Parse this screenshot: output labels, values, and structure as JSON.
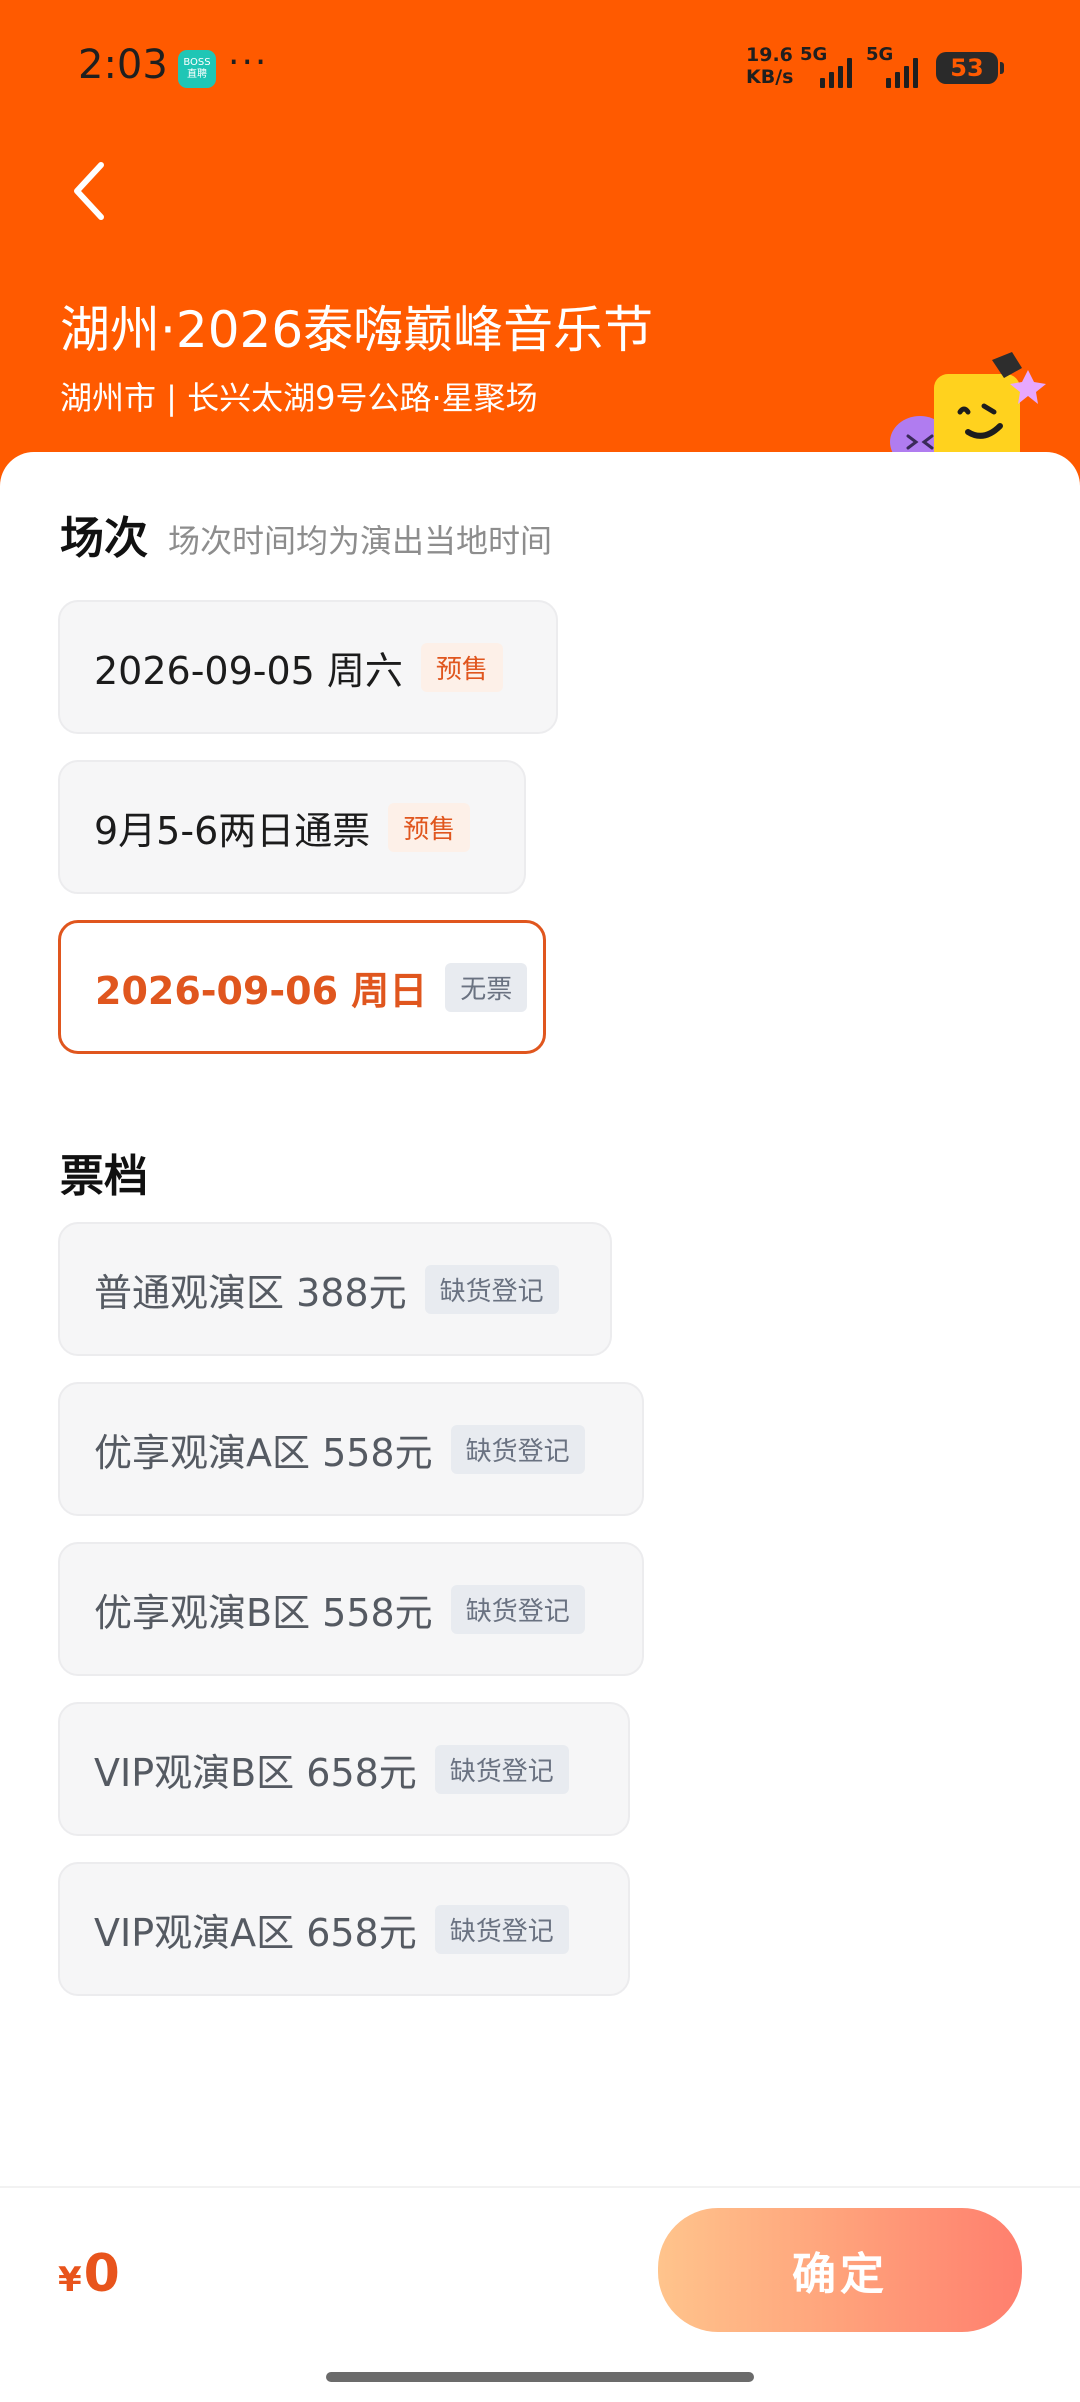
{
  "status_bar": {
    "time": "2:03",
    "app_badge_line1": "BOSS",
    "app_badge_line2": "直聘",
    "more": "···",
    "net_speed_value": "19.6",
    "net_speed_unit": "KB/s",
    "signal1_label": "5G",
    "signal2_label": "5G",
    "battery": "53"
  },
  "header": {
    "title": "湖州·2026泰嗨巅峰音乐节",
    "venue": "湖州市 | 长兴太湖9号公路·星聚场"
  },
  "sessions": {
    "title": "场次",
    "note": "场次时间均为演出当地时间",
    "items": [
      {
        "label": "2026-09-05  周六",
        "tag": "预售",
        "selected": false
      },
      {
        "label": "9月5-6两日通票",
        "tag": "预售",
        "selected": false
      },
      {
        "label": "2026-09-06 周日",
        "tag": "无票",
        "selected": true
      }
    ]
  },
  "tickets": {
    "title": "票档",
    "items": [
      {
        "label": "普通观演区 388元",
        "tag": "缺货登记"
      },
      {
        "label": "优享观演A区 558元",
        "tag": "缺货登记"
      },
      {
        "label": "优享观演B区 558元",
        "tag": "缺货登记"
      },
      {
        "label": "VIP观演B区 658元",
        "tag": "缺货登记"
      },
      {
        "label": "VIP观演A区 658元",
        "tag": "缺货登记"
      }
    ]
  },
  "footer": {
    "currency_symbol": "¥",
    "total": "0",
    "confirm_label": "确定"
  },
  "colors": {
    "brand_orange": "#ff5a00",
    "accent_red": "#e0561e",
    "tag_gray_bg": "#e8ebf0"
  }
}
